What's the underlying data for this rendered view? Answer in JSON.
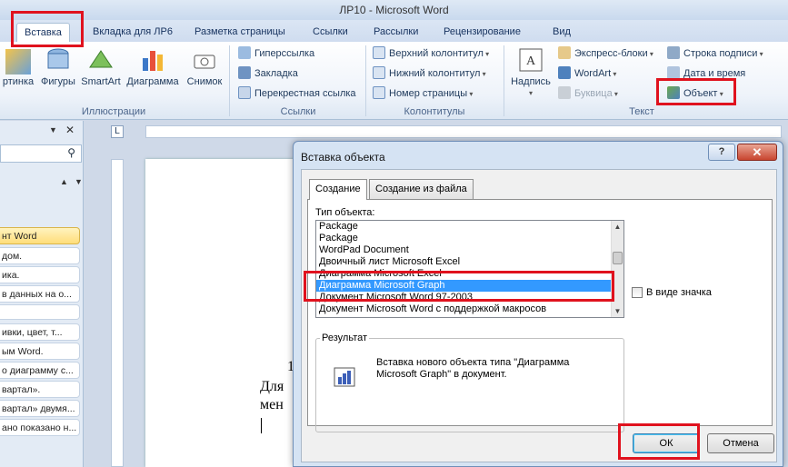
{
  "window": {
    "title": "ЛР10  -  Microsoft Word"
  },
  "tabs": [
    "Вставка",
    "Вкладка для ЛР6",
    "Разметка страницы",
    "Ссылки",
    "Рассылки",
    "Рецензирование",
    "Вид"
  ],
  "ribbon": {
    "illustrations": {
      "buttons": [
        "ртинка",
        "Фигуры",
        "SmartArt",
        "Диаграмма",
        "Снимок"
      ],
      "label": "Иллюстрации"
    },
    "links": {
      "items": [
        "Гиперссылка",
        "Закладка",
        "Перекрестная ссылка"
      ],
      "label": "Ссылки"
    },
    "headers": {
      "items": [
        "Верхний колонтитул",
        "Нижний колонтитул",
        "Номер страницы"
      ],
      "label": "Колонтитулы"
    },
    "text": {
      "textbox": "Надпись",
      "items": [
        "Экспресс-блоки",
        "WordArt",
        "Буквица"
      ],
      "items2": [
        "Строка подписи",
        "Дата и время",
        "Объект"
      ],
      "label": "Текст"
    }
  },
  "nav": {
    "items": [
      "нт Word",
      "дом.",
      "ика.",
      "в данных на о...",
      "ивки, цвет, т...",
      "ым Word.",
      "о диаграмму с...",
      "вартал».",
      "вартал» двумя...",
      "ано показано н..."
    ]
  },
  "document": {
    "line1": "1",
    "line2": "Для",
    "line3": "мен"
  },
  "dialog": {
    "title": "Вставка объекта",
    "tabs": [
      "Создание",
      "Создание из файла"
    ],
    "type_label": "Тип объекта:",
    "list": [
      "Package",
      "Package",
      "WordPad Document",
      "Двоичный лист Microsoft Excel",
      "Диаграмма Microsoft Excel",
      "Диаграмма Microsoft Graph",
      "Документ Microsoft Word 97-2003",
      "Документ Microsoft Word с поддержкой макросов"
    ],
    "selected_index": 5,
    "as_icon_label": "В виде значка",
    "result_label": "Результат",
    "result_text": "Вставка нового объекта типа \"Диаграмма Microsoft Graph\" в документ.",
    "ok": "ОК",
    "cancel": "Отмена",
    "help": "?",
    "close": "✕"
  },
  "colors": {
    "highlight": "#e0121e",
    "selection": "#3399ff"
  }
}
